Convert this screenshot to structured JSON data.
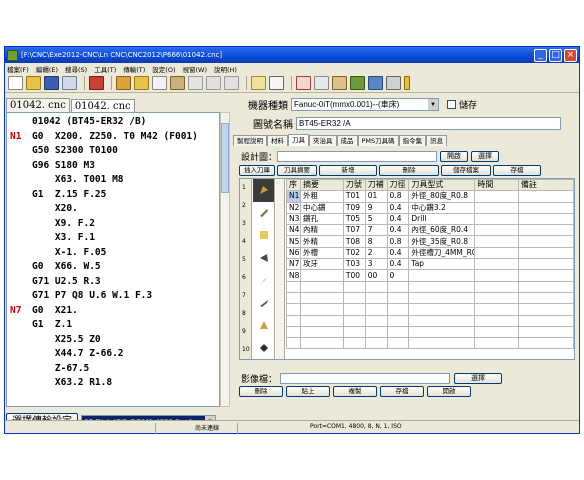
{
  "window": {
    "title": "[F:\\CNC\\Exe2012-CNC\\Ln CNC\\CNC2012\\P666\\01042.cnc]",
    "colors": {
      "titlebar": "#0a49d6",
      "code_number": "#cc0000",
      "selection": "#b7cbee"
    }
  },
  "menu": [
    "檔案(F)",
    "編輯(E)",
    "搜尋(S)",
    "工具(T)",
    "傳輸(T)",
    "設定(O)",
    "視窗(W)",
    "說明(H)"
  ],
  "left": {
    "tabs": [
      "01042. cnc",
      "01042. cnc"
    ],
    "code_lines": [
      {
        "n": "",
        "t": "01042 (BT45-ER32 /B)"
      },
      {
        "n": "N1",
        "t": "G0  X200. Z250. T0 M42 (F001)"
      },
      {
        "n": "",
        "t": "G50 S2300 T0100"
      },
      {
        "n": "",
        "t": "G96 S180 M3"
      },
      {
        "n": "",
        "t": "    X63. T001 M8"
      },
      {
        "n": "",
        "t": "G1  Z.15 F.25"
      },
      {
        "n": "",
        "t": "    X20."
      },
      {
        "n": "",
        "t": "    X9. F.2"
      },
      {
        "n": "",
        "t": "    X3. F.1"
      },
      {
        "n": "",
        "t": "    X-1. F.05"
      },
      {
        "n": "",
        "t": "G0  X66. W.5"
      },
      {
        "n": "",
        "t": "G71 U2.5 R.3"
      },
      {
        "n": "",
        "t": "G71 P7 Q8 U.6 W.1 F.3"
      },
      {
        "n": "N7",
        "t": "G0  X21."
      },
      {
        "n": "",
        "t": "G1  Z.1"
      },
      {
        "n": "",
        "t": "    X25.5 Z0"
      },
      {
        "n": "",
        "t": "    X44.7 Z-66.2"
      },
      {
        "n": "",
        "t": "    Z-67.5"
      },
      {
        "n": "",
        "t": "    X63.2 R1.8"
      }
    ],
    "select_button": "選擇傳輸設定",
    "port_value": "02-Disk-ISO.COM1.4800.8.n.1"
  },
  "right": {
    "machine_label": "機器種類",
    "machine_value": "Fanuc-0iT(mmx0.001)--(車床)",
    "save_label": "儲存",
    "drawing_label": "圖號名稱",
    "drawing_value": "BT45-ER32 /A",
    "tabs": [
      "製程說明",
      "材料",
      "刀具",
      "夾治具",
      "成品",
      "PMS刀具碼",
      "指令集",
      "訊息"
    ],
    "active_tab": 2,
    "design_label": "設計圖：",
    "open_label": "開啟",
    "select_label": "選擇",
    "toolbar_buttons": [
      "插入刀庫",
      "刀具摘要",
      "新增",
      "刪除",
      "儲存檔案",
      "存檔"
    ],
    "table_headers": [
      "序",
      "摘要",
      "刀號",
      "刀補",
      "刀徑",
      "刀具型式",
      "時間",
      "備註"
    ],
    "rows": [
      [
        "N1",
        "外粗",
        "T01",
        "01",
        "0.8",
        "外徑_80度_R0.8",
        "",
        ""
      ],
      [
        "N2",
        "中心鑽",
        "T09",
        "9",
        "0.4",
        "中心鑽3.2",
        "",
        ""
      ],
      [
        "N3",
        "鑽孔",
        "T05",
        "5",
        "0.4",
        "Drill",
        "",
        ""
      ],
      [
        "N4",
        "內精",
        "T07",
        "7",
        "0.4",
        "內徑_60度_R0.4",
        "",
        ""
      ],
      [
        "N5",
        "外精",
        "T08",
        "8",
        "0.8",
        "外徑_35度_R0.8",
        "",
        ""
      ],
      [
        "N6",
        "外槽",
        "T02",
        "2",
        "0.4",
        "外徑槽刀_4MM_R0",
        "",
        ""
      ],
      [
        "N7",
        "攻牙",
        "T03",
        "3",
        "0.4",
        "Tap",
        "",
        ""
      ],
      [
        "N8",
        "",
        "T00",
        "00",
        "0",
        "",
        "",
        ""
      ]
    ],
    "row_numbers": [
      "1",
      "2",
      "3",
      "4",
      "5",
      "6",
      "7",
      "8",
      "9",
      "10"
    ],
    "image_label": "影像檔：",
    "image_select": "選擇",
    "actions": [
      "刪除",
      "貼上",
      "複製",
      "存檔",
      "開啟"
    ]
  },
  "status": {
    "left": "尚未連線",
    "right": "Port=COM1, 4800, 8, N, 1, ISO"
  }
}
